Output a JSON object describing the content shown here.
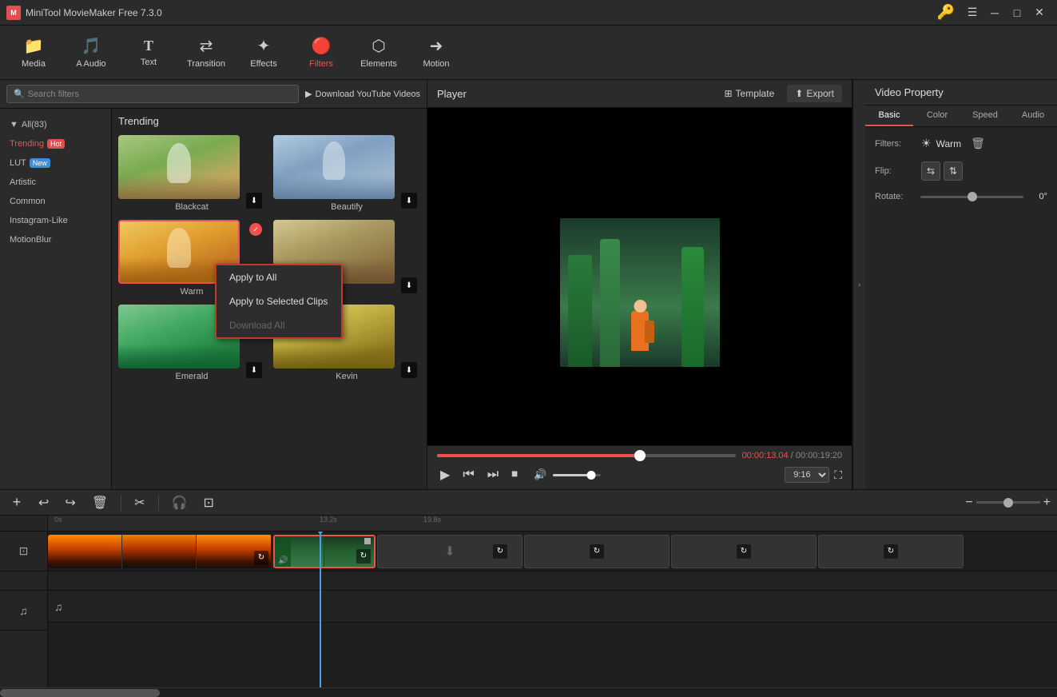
{
  "app": {
    "title": "MiniTool MovieMaker Free 7.3.0",
    "key_icon": "🔑"
  },
  "toolbar": {
    "items": [
      {
        "id": "media",
        "label": "Media",
        "icon": "📁",
        "active": false
      },
      {
        "id": "audio",
        "label": "Audio",
        "icon": "🎵",
        "active": false
      },
      {
        "id": "text",
        "label": "Text",
        "icon": "T",
        "active": false
      },
      {
        "id": "transition",
        "label": "Transition",
        "icon": "↔",
        "active": false
      },
      {
        "id": "effects",
        "label": "Effects",
        "icon": "✨",
        "active": false
      },
      {
        "id": "filters",
        "label": "Filters",
        "icon": "🔴",
        "active": true
      },
      {
        "id": "elements",
        "label": "Elements",
        "icon": "⬡",
        "active": false
      },
      {
        "id": "motion",
        "label": "Motion",
        "icon": "➜",
        "active": false
      }
    ]
  },
  "filters_panel": {
    "search_placeholder": "Search filters",
    "yt_download_label": "Download YouTube Videos",
    "all_label": "All(83)",
    "categories": [
      {
        "id": "trending",
        "label": "Trending",
        "badge": "Hot",
        "active": true
      },
      {
        "id": "lut",
        "label": "LUT",
        "badge": "New"
      },
      {
        "id": "artistic",
        "label": "Artistic"
      },
      {
        "id": "common",
        "label": "Common"
      },
      {
        "id": "instagram",
        "label": "Instagram-Like"
      },
      {
        "id": "motionblur",
        "label": "MotionBlur"
      }
    ],
    "section_title": "Trending",
    "filters": [
      {
        "name": "Blackcat",
        "has_download": true,
        "selected": false
      },
      {
        "name": "Beautify",
        "has_download": true,
        "selected": false
      },
      {
        "name": "Warm",
        "has_download": false,
        "selected": true,
        "context_menu": true
      },
      {
        "name": "",
        "has_download": true,
        "selected": false
      },
      {
        "name": "Emerald",
        "has_download": true,
        "selected": false
      },
      {
        "name": "Kevin",
        "has_download": true,
        "selected": false
      }
    ]
  },
  "context_menu": {
    "items": [
      {
        "id": "apply-all",
        "label": "Apply to All",
        "disabled": false
      },
      {
        "id": "apply-selected",
        "label": "Apply to Selected Clips",
        "disabled": false
      },
      {
        "id": "download-all",
        "label": "Download All",
        "disabled": true
      }
    ]
  },
  "player": {
    "title": "Player",
    "template_label": "Template",
    "export_label": "Export",
    "current_time": "00:00:13.04",
    "total_time": "00:00:19:20",
    "aspect_ratio": "9:16",
    "progress_percent": 68
  },
  "properties": {
    "title": "Video Property",
    "tabs": [
      "Basic",
      "Color",
      "Speed",
      "Audio"
    ],
    "active_tab": "Basic",
    "filters_label": "Filters:",
    "filter_name": "Warm",
    "flip_label": "Flip:",
    "rotate_label": "Rotate:",
    "rotate_value": "0°",
    "rotate_deg": 0
  },
  "timeline": {
    "time_marks": [
      "0s",
      "13.2s",
      "19.8s"
    ],
    "zoom_level": 50
  }
}
